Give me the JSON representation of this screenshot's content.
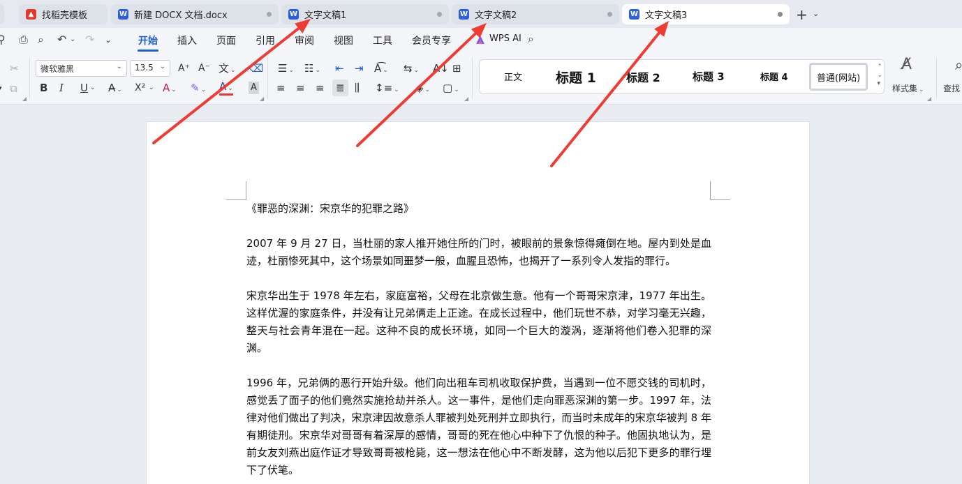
{
  "tabs": [
    {
      "label": "找稻壳模板",
      "icon": "docer-icon"
    },
    {
      "label": "新建 DOCX 文档.docx",
      "icon": "word-doc-icon"
    },
    {
      "label": "文字文稿1",
      "icon": "word-doc-icon"
    },
    {
      "label": "文字文稿2",
      "icon": "word-doc-icon"
    },
    {
      "label": "文字文稿3",
      "icon": "word-doc-icon",
      "active": true
    }
  ],
  "menu": {
    "items": [
      "开始",
      "插入",
      "页面",
      "引用",
      "审阅",
      "视图",
      "工具",
      "会员专享"
    ],
    "active": "开始",
    "wps_ai": "WPS AI"
  },
  "ribbon": {
    "font_name": "微软雅黑",
    "font_size": "13.5",
    "styles": [
      "正文",
      "标题 1",
      "标题 2",
      "标题 3",
      "标题 4",
      "普通(网站)"
    ],
    "selected_style": "普通(网站)",
    "style_set_label": "样式集",
    "find_label": "查找",
    "symbols": {
      "grow_font": "A⁺",
      "shrink_font": "A⁻",
      "bold": "B",
      "italic": "I",
      "underline": "U",
      "superscript": "X²",
      "char_shade": "A"
    }
  },
  "document": {
    "title": "《罪恶的深渊：宋京华的犯罪之路》",
    "paragraphs": [
      "2007 年 9 月 27 日，当杜丽的家人推开她住所的门时，被眼前的景象惊得瘫倒在地。屋内到处是血迹，杜丽惨死其中，这个场景如同噩梦一般，血腥且恐怖，也揭开了一系列令人发指的罪行。",
      "宋京华出生于 1978 年左右，家庭富裕，父母在北京做生意。他有一个哥哥宋京津，1977 年出生。这样优渥的家庭条件，并没有让兄弟俩走上正途。在成长过程中，他们玩世不恭，对学习毫无兴趣，整天与社会青年混在一起。这种不良的成长环境，如同一个巨大的漩涡，逐渐将他们卷入犯罪的深渊。",
      "1996 年，兄弟俩的恶行开始升级。他们向出租车司机收取保护费，当遇到一位不愿交钱的司机时，感觉丢了面子的他们竟然实施抢劫并杀人。这一事件，是他们走向罪恶深渊的第一步。1997 年，法律对他们做出了判决，宋京津因故意杀人罪被判处死刑并立即执行，而当时未成年的宋京华被判 8 年有期徒刑。宋京华对哥哥有着深厚的感情，哥哥的死在他心中种下了仇恨的种子。他固执地认为，是前女友刘燕出庭作证才导致哥哥被枪毙，这一想法在他心中不断发酵，这为他以后犯下更多的罪行埋下了伏笔。"
    ]
  },
  "annotations": {
    "arrow_color": "#ee3b33"
  }
}
